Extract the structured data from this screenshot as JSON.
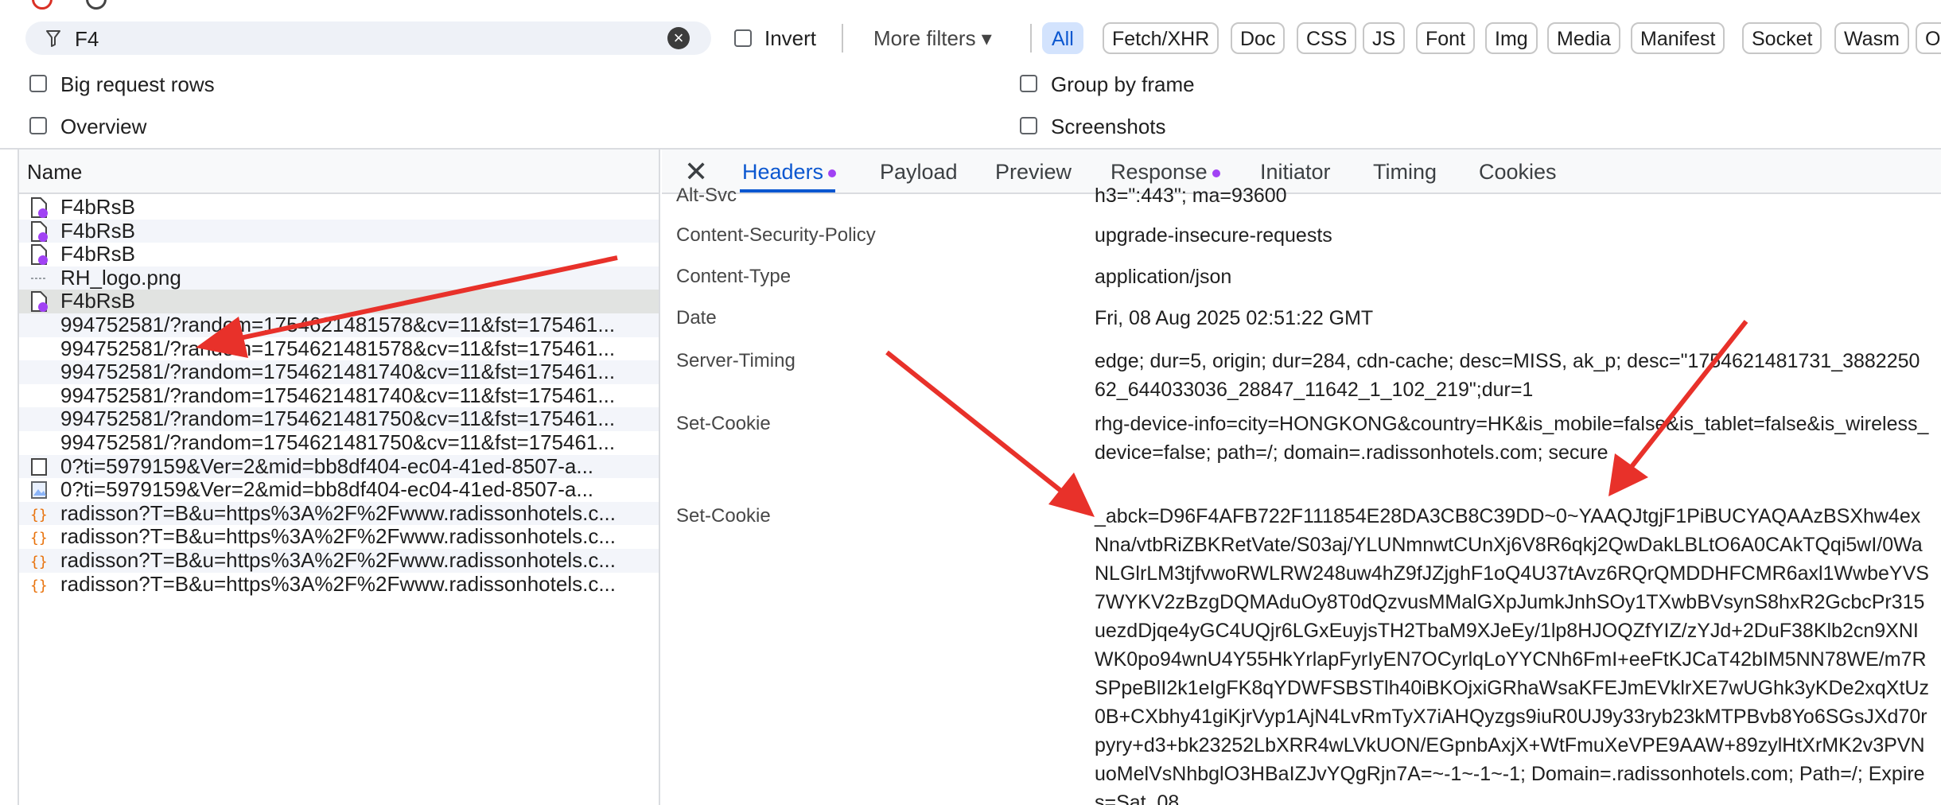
{
  "filter": {
    "value": "F4",
    "invert_label": "Invert",
    "more_filters_label": "More filters ▾",
    "types": [
      "All",
      "Fetch/XHR",
      "Doc",
      "CSS",
      "JS",
      "Font",
      "Img",
      "Media",
      "Manifest",
      "Socket",
      "Wasm",
      "O"
    ],
    "active_type": "All"
  },
  "options": {
    "big_rows": "Big request rows",
    "overview": "Overview",
    "group_by_frame": "Group by frame",
    "screenshots": "Screenshots"
  },
  "requests": {
    "header": "Name",
    "rows": [
      {
        "name": "F4bRsB",
        "icon": "doc-purple-icon"
      },
      {
        "name": "F4bRsB",
        "icon": "doc-purple-icon"
      },
      {
        "name": "F4bRsB",
        "icon": "doc-purple-icon"
      },
      {
        "name": "RH_logo.png",
        "icon": "image-dash-icon"
      },
      {
        "name": "F4bRsB",
        "icon": "doc-purple-icon",
        "selected": true
      },
      {
        "name": "994752581/?random=1754621481578&cv=11&fst=175461...",
        "icon": "none"
      },
      {
        "name": "994752581/?random=1754621481578&cv=11&fst=175461...",
        "icon": "none"
      },
      {
        "name": "994752581/?random=1754621481740&cv=11&fst=175461...",
        "icon": "none"
      },
      {
        "name": "994752581/?random=1754621481740&cv=11&fst=175461...",
        "icon": "none"
      },
      {
        "name": "994752581/?random=1754621481750&cv=11&fst=175461...",
        "icon": "none"
      },
      {
        "name": "994752581/?random=1754621481750&cv=11&fst=175461...",
        "icon": "none"
      },
      {
        "name": "0?ti=5979159&Ver=2&mid=bb8df404-ec04-41ed-8507-a...",
        "icon": "square-icon"
      },
      {
        "name": "0?ti=5979159&Ver=2&mid=bb8df404-ec04-41ed-8507-a...",
        "icon": "image-icon"
      },
      {
        "name": "radisson?T=B&u=https%3A%2F%2Fwww.radissonhotels.c...",
        "icon": "script-icon"
      },
      {
        "name": "radisson?T=B&u=https%3A%2F%2Fwww.radissonhotels.c...",
        "icon": "script-icon"
      },
      {
        "name": "radisson?T=B&u=https%3A%2F%2Fwww.radissonhotels.c...",
        "icon": "script-icon"
      },
      {
        "name": "radisson?T=B&u=https%3A%2F%2Fwww.radissonhotels.c...",
        "icon": "script-icon"
      }
    ]
  },
  "details": {
    "tabs": [
      "Headers",
      "Payload",
      "Preview",
      "Response",
      "Initiator",
      "Timing",
      "Cookies"
    ],
    "active_tab": "Headers",
    "headers": [
      {
        "key": "Alt-Svc",
        "value": "h3=\":443\"; ma=93600"
      },
      {
        "key": "Content-Security-Policy",
        "value": "upgrade-insecure-requests"
      },
      {
        "key": "Content-Type",
        "value": "application/json"
      },
      {
        "key": "Date",
        "value": "Fri, 08 Aug 2025 02:51:22 GMT"
      },
      {
        "key": "Server-Timing",
        "value": "edge; dur=5, origin; dur=284, cdn-cache; desc=MISS, ak_p; desc=\"1754621481731_388225062_644033036_28847_11642_1_102_219\";dur=1"
      },
      {
        "key": "Set-Cookie",
        "value": "rhg-device-info=city=HONGKONG&country=HK&is_mobile=false&is_tablet=false&is_wireless_device=false; path=/; domain=.radissonhotels.com; secure"
      },
      {
        "key": "Set-Cookie",
        "value": "_abck=D96F4AFB722F111854E28DA3CB8C39DD~0~YAAQJtgjF1PiBUCYAQAAzBSXhw4exNna/vtbRiZBKRetVate/S03aj/YLUNmnwtCUnXj6V8R6qkj2QwDakLBLtO6A0CAkTQqi5wI/0WaNLGlrLM3tjfvwoRWLRW248uw4hZ9fJZjghF1oQ4U37tAvz6RQrQMDDHFCMR6axl1WwbeYVS7WYKV2zBzgDQMAduOy8T0dQzvusMMalGXpJumkJnhSOy1TXwbBVsynS8hxR2GcbcPr315uezdDjqe4yGC4UQjr6LGxEuyjsTH2TbaM9XJeEy/1lp8HJOQZfYIZ/zYJd+2DuF38Klb2cn9XNIWK0po94wnU4Y55HkYrlapFyrIyEN7OCyrlqLoYYCNh6FmI+eeFtKJCaT42bIM5NN78WE/m7RSPpeBlI2k1eIgFK8qYDWFSBSTlh40iBKOjxiGRhaWsaKFEJmEVklrXE7wUGhk3yKDe2xqXtUz0B+CXbhy41giKjrVyp1AjN4LvRmTyX7iAHQyzgs9iuR0UJ9y33ryb23kMTPBvb8Yo6SGsJXd70rpyry+d3+bk23252LbXRR4wLVkUON/EGpnbAxjX+WtFmuXeVPE9AAW+89zylHtXrMK2v3PVNuoMelVsNhbglO3HBaIZJvYQgRjn7A=~-1~-1~-1; Domain=.radissonhotels.com; Path=/; Expires=Sat, 08"
      }
    ]
  }
}
